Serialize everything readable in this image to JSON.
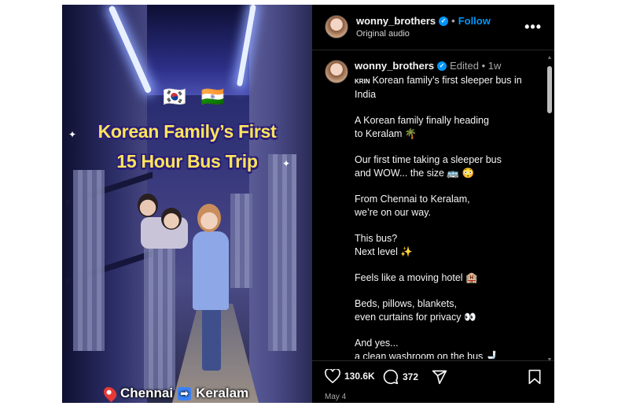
{
  "video": {
    "flags": "🇰🇷 🇮🇳",
    "title_line1": "Korean Family’s First",
    "title_line2": "15 Hour Bus Trip",
    "route_from": "Chennai",
    "route_arrow": "➡",
    "route_to": "Keralam"
  },
  "header": {
    "username": "wonny_brothers",
    "verified_mark": "✓",
    "separator": "•",
    "follow_label": "Follow",
    "subtitle": "Original audio",
    "more_label": "•••"
  },
  "caption": {
    "username": "wonny_brothers",
    "verified_mark": "✓",
    "meta": "Edited • 1w",
    "krin": "KRIN",
    "paragraphs": [
      "Korean family’s first sleeper bus in India",
      "A Korean family finally heading\nto Keralam 🌴",
      "Our first time taking a sleeper bus\nand WOW... the size 🚌 😳",
      "From Chennai to Keralam,\nwe’re on our way.",
      "This bus?\nNext level ✨",
      "Feels like a moving hotel 🏨",
      "Beds, pillows, blankets,\neven curtains for privacy 👀",
      "And yes...\na clean washroom on the bus 🚽"
    ]
  },
  "actions": {
    "likes": "130.6K",
    "comments": "372",
    "date": "May 4"
  },
  "colors": {
    "accent": "#0095f6",
    "title_yellow": "#ffe45c",
    "title_outline": "#2a1e78"
  }
}
